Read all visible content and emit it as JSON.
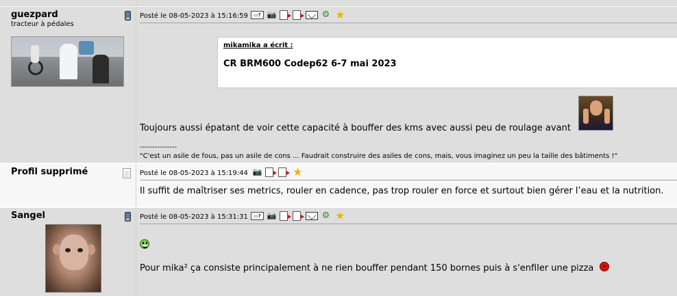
{
  "posts": [
    {
      "author": {
        "name": "guezpard",
        "title": "tracteur à pédales"
      },
      "date": "Posté le 08-05-2023 à 15:16:59",
      "quote": {
        "author": "mikamika a écrit :",
        "text": "CR BRM600 Codep62 6-7 mai 2023"
      },
      "text": "Toujours aussi épatant de voir cette capacité à bouffer des kms avec aussi peu de roulage avant",
      "signature": {
        "separator": "---------------",
        "text": "\"C'est un asile de fous, pas un asile de cons ... Faudrait construire des asiles de cons, mais, vous imaginez un peu la taille des bâtiments !\""
      },
      "icons": [
        "phone-icon",
        "quote-icon",
        "profile-icon",
        "edit-icon",
        "add-icon",
        "mail-icon",
        "alert-icon",
        "favorite-icon"
      ]
    },
    {
      "author": {
        "name": "Profil supprimé"
      },
      "date": "Posté le 08-05-2023 à 15:19:44",
      "text": "Il suffit de maîtriser ses metrics, rouler en cadence, pas trop rouler en force et surtout bien gérer l’eau et la nutrition.",
      "icons": [
        "document-icon",
        "profile-icon",
        "edit-icon",
        "add-icon",
        "favorite-icon"
      ]
    },
    {
      "author": {
        "name": "Sangel"
      },
      "date": "Posté le 08-05-2023 à 15:31:31",
      "text": "Pour mika² ça consiste principalement à ne rien bouffer pendant 150 bornes puis à s'enfiler une pizza",
      "icons": [
        "phone-icon",
        "quote-icon",
        "profile-icon",
        "edit-icon",
        "add-icon",
        "mail-icon",
        "alert-icon",
        "favorite-icon"
      ]
    }
  ],
  "toolbar": {
    "quote_box_label": "?"
  }
}
